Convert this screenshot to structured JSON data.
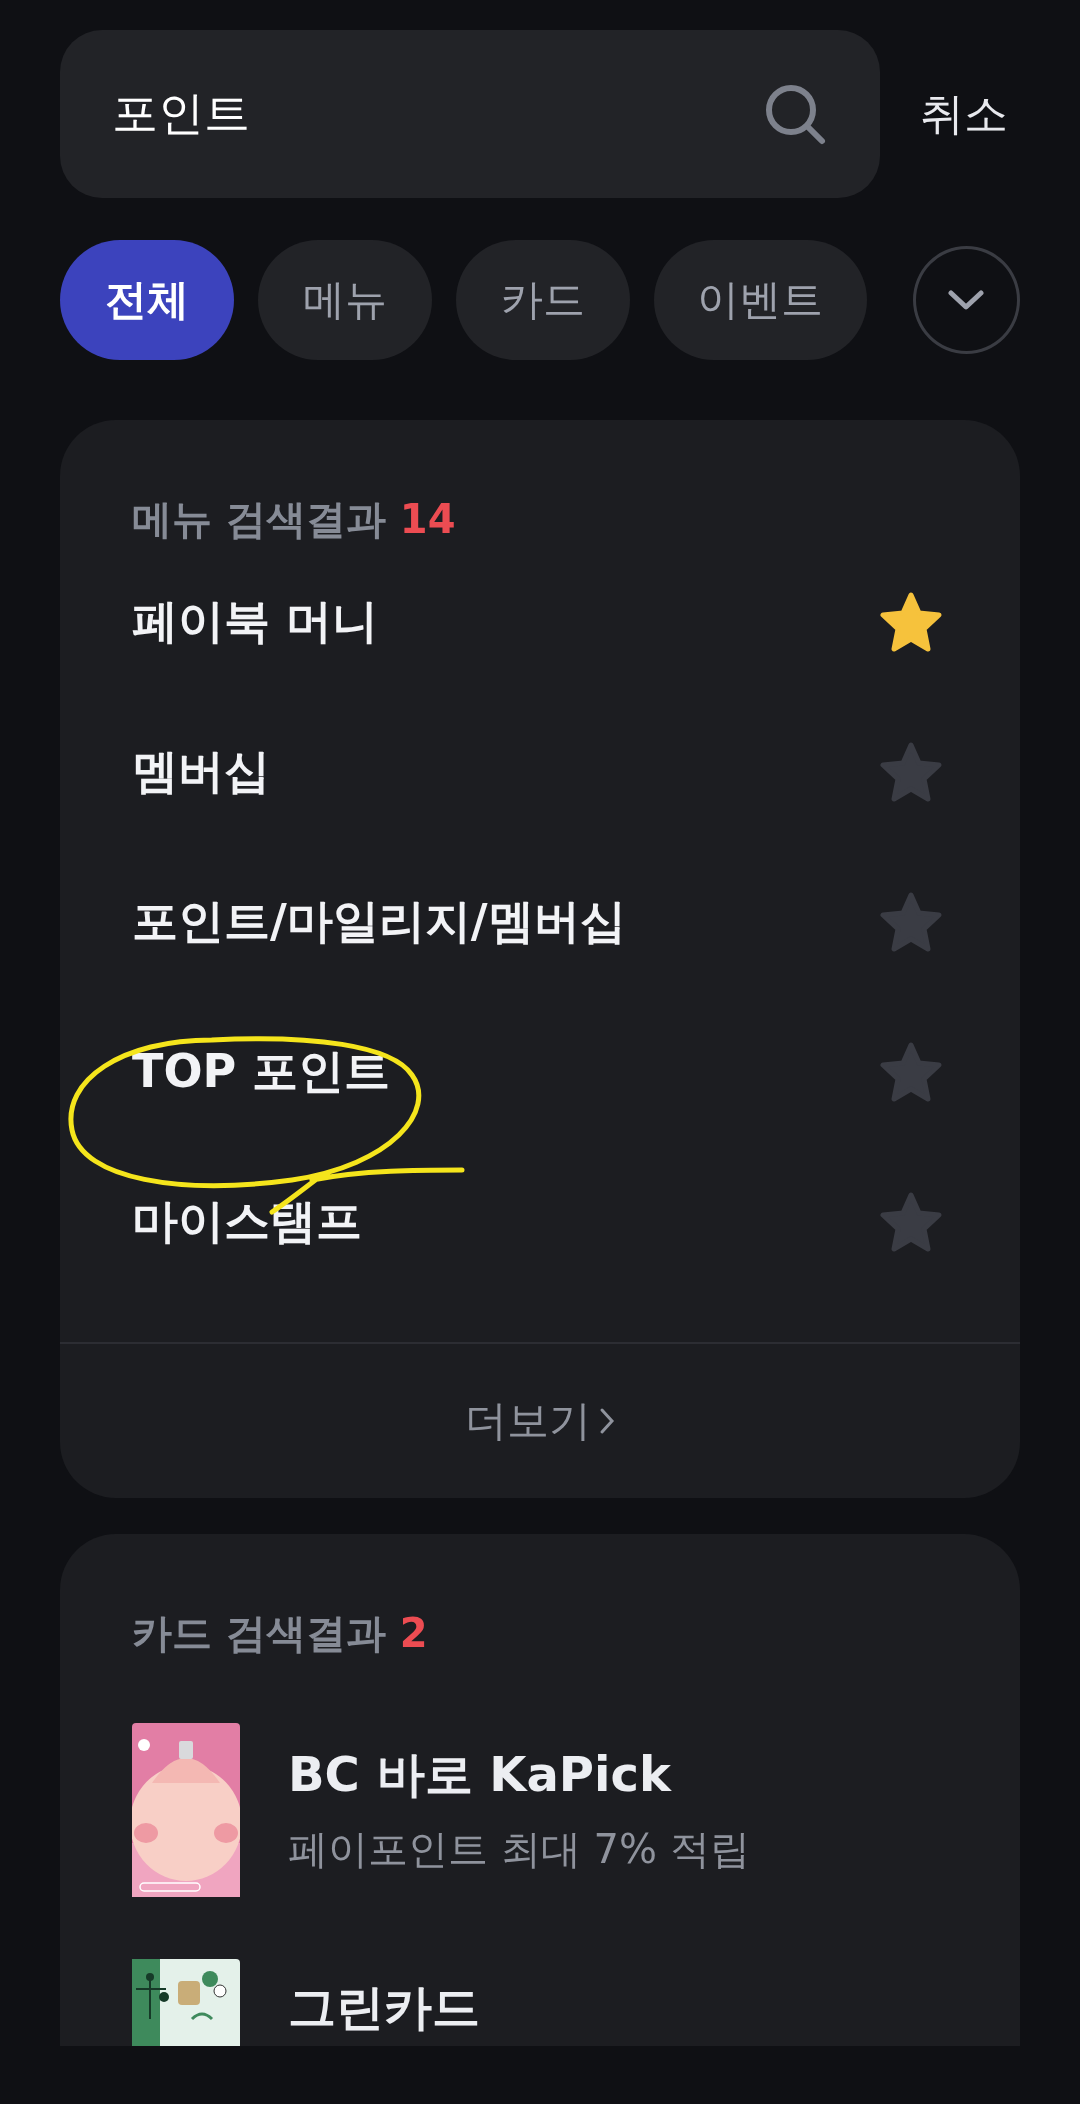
{
  "search": {
    "value": "포인트",
    "cancel": "취소"
  },
  "filters": [
    {
      "label": "전체",
      "selected": true
    },
    {
      "label": "메뉴",
      "selected": false
    },
    {
      "label": "카드",
      "selected": false
    },
    {
      "label": "이벤트",
      "selected": false
    }
  ],
  "menu_results": {
    "title": "메뉴 검색결과",
    "count": "14",
    "items": [
      {
        "label": "페이북 머니",
        "favorite": true
      },
      {
        "label": "멤버십",
        "favorite": false
      },
      {
        "label": "포인트/마일리지/멤버십",
        "favorite": false
      },
      {
        "label": "TOP 포인트",
        "favorite": false
      },
      {
        "label": "마이스탬프",
        "favorite": false
      }
    ],
    "more": "더보기"
  },
  "card_results": {
    "title": "카드 검색결과",
    "count": "2",
    "items": [
      {
        "name": "BC 바로 KaPick",
        "description": "페이포인트 최대 7% 적립",
        "kind": "picture"
      },
      {
        "name": "그린카드",
        "kind": "picture"
      }
    ]
  }
}
